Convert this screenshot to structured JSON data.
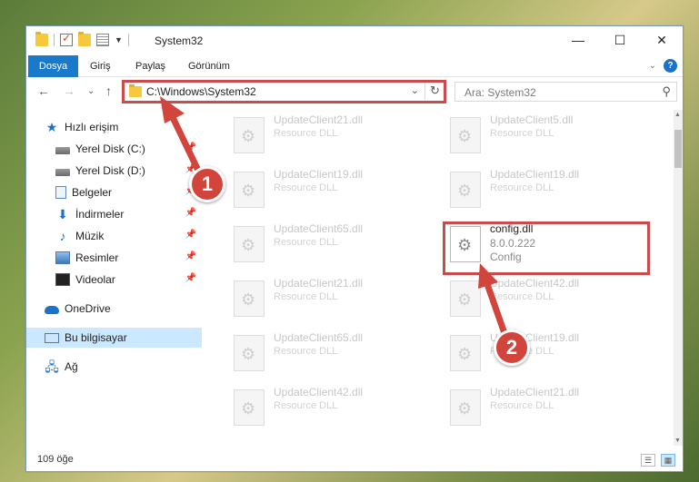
{
  "window": {
    "title": "System32",
    "controls": {
      "minimize": "—",
      "maximize": "☐",
      "close": "✕"
    }
  },
  "ribbon": {
    "tabs": [
      "Dosya",
      "Giriş",
      "Paylaş",
      "Görünüm"
    ],
    "help": "?",
    "expand": "⌄"
  },
  "nav": {
    "back": "←",
    "forward": "→",
    "recent": "⌄",
    "up": "↑",
    "address": "C:\\Windows\\System32",
    "refresh": "↻",
    "search_placeholder": "Ara: System32"
  },
  "sidebar": {
    "items": [
      {
        "label": "Hızlı erişim",
        "icon": "star-icon"
      },
      {
        "label": "Yerel Disk (C:)",
        "icon": "disk-icon",
        "pinned": true
      },
      {
        "label": "Yerel Disk (D:)",
        "icon": "disk-icon",
        "pinned": true
      },
      {
        "label": "Belgeler",
        "icon": "documents-icon",
        "pinned": true
      },
      {
        "label": "İndirmeler",
        "icon": "downloads-icon",
        "pinned": true
      },
      {
        "label": "Müzik",
        "icon": "music-icon",
        "pinned": true
      },
      {
        "label": "Resimler",
        "icon": "pictures-icon",
        "pinned": true
      },
      {
        "label": "Videolar",
        "icon": "videos-icon",
        "pinned": true
      },
      {
        "label": "OneDrive",
        "icon": "onedrive-icon"
      },
      {
        "label": "Bu bilgisayar",
        "icon": "this-pc-icon",
        "selected": true
      },
      {
        "label": "Ağ",
        "icon": "network-icon"
      }
    ]
  },
  "files": {
    "left": [
      {
        "name": "UpdateClient21.dll",
        "type": "Resource DLL"
      },
      {
        "name": "UpdateClient19.dll",
        "type": "Resource DLL"
      },
      {
        "name": "UpdateClient65.dll",
        "type": "Resource DLL"
      },
      {
        "name": "UpdateClient21.dll",
        "type": "Resource DLL"
      },
      {
        "name": "UpdateClient65.dll",
        "type": "Resource DLL"
      },
      {
        "name": "UpdateClient42.dll",
        "type": "Resource DLL"
      }
    ],
    "right": [
      {
        "name": "UpdateClient5.dll",
        "type": "Resource DLL"
      },
      {
        "name": "UpdateClient19.dll",
        "type": "Resource DLL"
      },
      {
        "name": "config.dll",
        "version": "8.0.0.222",
        "description": "Config",
        "highlighted": true
      },
      {
        "name": "UpdateClient42.dll",
        "type": "Resource DLL"
      },
      {
        "name": "UpdateClient19.dll",
        "type": "Resource DLL"
      },
      {
        "name": "UpdateClient21.dll",
        "type": "Resource DLL"
      }
    ]
  },
  "status": {
    "item_count": "109 öğe"
  },
  "annotations": {
    "step1": "1",
    "step2": "2",
    "color": "#d2453c"
  }
}
